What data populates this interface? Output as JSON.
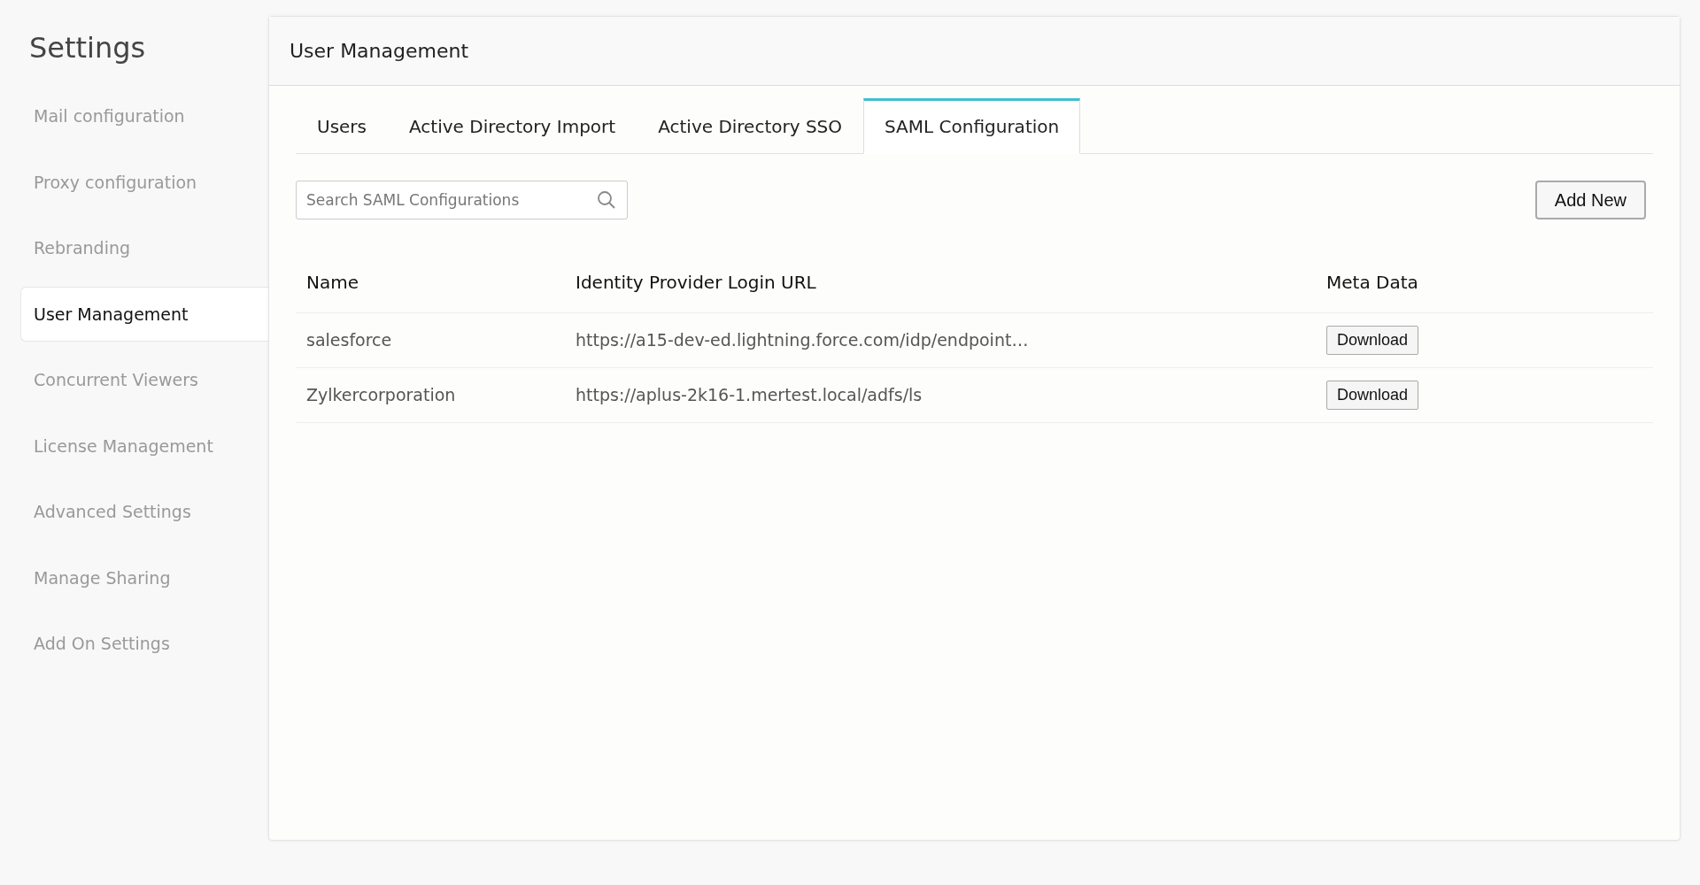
{
  "sidebar": {
    "title": "Settings",
    "items": [
      {
        "label": "Mail configuration",
        "selected": false
      },
      {
        "label": "Proxy configuration",
        "selected": false
      },
      {
        "label": "Rebranding",
        "selected": false
      },
      {
        "label": "User Management",
        "selected": true
      },
      {
        "label": "Concurrent Viewers",
        "selected": false
      },
      {
        "label": "License Management",
        "selected": false
      },
      {
        "label": "Advanced Settings",
        "selected": false
      },
      {
        "label": "Manage Sharing",
        "selected": false
      },
      {
        "label": "Add On Settings",
        "selected": false
      }
    ]
  },
  "panel": {
    "title": "User Management",
    "tabs": [
      {
        "label": "Users",
        "selected": false
      },
      {
        "label": "Active Directory Import",
        "selected": false
      },
      {
        "label": "Active Directory SSO",
        "selected": false
      },
      {
        "label": "SAML Configuration",
        "selected": true
      }
    ],
    "search": {
      "placeholder": "Search SAML Configurations"
    },
    "add_button": "Add New",
    "table": {
      "columns": [
        "Name",
        "Identity Provider Login URL",
        "Meta Data"
      ],
      "rows": [
        {
          "name": "salesforce",
          "url": "https://a15-dev-ed.lightning.force.com/idp/endpoint…",
          "action": "Download"
        },
        {
          "name": "Zylkercorporation",
          "url": "https://aplus-2k16-1.mertest.local/adfs/ls",
          "action": "Download"
        }
      ]
    }
  }
}
